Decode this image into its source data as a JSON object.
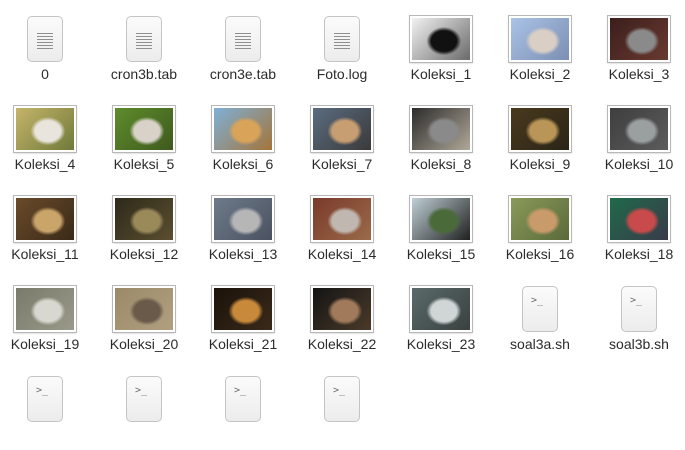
{
  "files": [
    {
      "name": "0",
      "kind": "text",
      "icon": "text-document-icon"
    },
    {
      "name": "cron3b.tab",
      "kind": "text",
      "icon": "text-document-icon"
    },
    {
      "name": "cron3e.tab",
      "kind": "text",
      "icon": "text-document-icon"
    },
    {
      "name": "Foto.log",
      "kind": "text",
      "icon": "text-document-icon"
    },
    {
      "name": "Koleksi_1",
      "kind": "image",
      "icon": "image-thumbnail-icon",
      "colors": [
        "#f2f2f2",
        "#111111",
        "#6a6a6a"
      ]
    },
    {
      "name": "Koleksi_2",
      "kind": "image",
      "icon": "image-thumbnail-icon",
      "colors": [
        "#aac3e6",
        "#d9cfc4",
        "#7c8fb3"
      ]
    },
    {
      "name": "Koleksi_3",
      "kind": "image",
      "icon": "image-thumbnail-icon",
      "colors": [
        "#3b1e1c",
        "#8a8a8a",
        "#6a3a30"
      ]
    },
    {
      "name": "Koleksi_4",
      "kind": "image",
      "icon": "image-thumbnail-icon",
      "colors": [
        "#c6b46a",
        "#e9e4dc",
        "#6f7a3a"
      ]
    },
    {
      "name": "Koleksi_5",
      "kind": "image",
      "icon": "image-thumbnail-icon",
      "colors": [
        "#5e8c2c",
        "#d8d2c8",
        "#3e5a1e"
      ]
    },
    {
      "name": "Koleksi_6",
      "kind": "image",
      "icon": "image-thumbnail-icon",
      "colors": [
        "#7fb0d6",
        "#d9a35a",
        "#a3743a"
      ]
    },
    {
      "name": "Koleksi_7",
      "kind": "image",
      "icon": "image-thumbnail-icon",
      "colors": [
        "#5a6c80",
        "#c79d72",
        "#3a3a3a"
      ]
    },
    {
      "name": "Koleksi_8",
      "kind": "image",
      "icon": "image-thumbnail-icon",
      "colors": [
        "#2c2c2c",
        "#8a8a8a",
        "#b0a898"
      ]
    },
    {
      "name": "Koleksi_9",
      "kind": "image",
      "icon": "image-thumbnail-icon",
      "colors": [
        "#4a3a1e",
        "#b99558",
        "#2a2416"
      ]
    },
    {
      "name": "Koleksi_10",
      "kind": "image",
      "icon": "image-thumbnail-icon",
      "colors": [
        "#3e3e3e",
        "#9aa0a0",
        "#5c5c5c"
      ]
    },
    {
      "name": "Koleksi_11",
      "kind": "image",
      "icon": "image-thumbnail-icon",
      "colors": [
        "#6a4a2a",
        "#caa56a",
        "#3a2a18"
      ]
    },
    {
      "name": "Koleksi_12",
      "kind": "image",
      "icon": "image-thumbnail-icon",
      "colors": [
        "#2e2a1a",
        "#9a8a5a",
        "#5a4e30"
      ]
    },
    {
      "name": "Koleksi_13",
      "kind": "image",
      "icon": "image-thumbnail-icon",
      "colors": [
        "#6e7a8a",
        "#b6b6b6",
        "#4a5260"
      ]
    },
    {
      "name": "Koleksi_14",
      "kind": "image",
      "icon": "image-thumbnail-icon",
      "colors": [
        "#7a3a2a",
        "#c0b8b0",
        "#9a6a4a"
      ]
    },
    {
      "name": "Koleksi_15",
      "kind": "image",
      "icon": "image-thumbnail-icon",
      "colors": [
        "#bfcfd6",
        "#4a6a3a",
        "#202020"
      ]
    },
    {
      "name": "Koleksi_16",
      "kind": "image",
      "icon": "image-thumbnail-icon",
      "colors": [
        "#8a9a5a",
        "#c99a6a",
        "#5a6a3a"
      ]
    },
    {
      "name": "Koleksi_18",
      "kind": "image",
      "icon": "image-thumbnail-icon",
      "colors": [
        "#1f6a4a",
        "#c84a4a",
        "#3a3a4a"
      ]
    },
    {
      "name": "Koleksi_19",
      "kind": "image",
      "icon": "image-thumbnail-icon",
      "colors": [
        "#7a7a6a",
        "#d8d8d0",
        "#9a9a8a"
      ]
    },
    {
      "name": "Koleksi_20",
      "kind": "image",
      "icon": "image-thumbnail-icon",
      "colors": [
        "#9a8a6a",
        "#6a5a4a",
        "#b0a080"
      ]
    },
    {
      "name": "Koleksi_21",
      "kind": "image",
      "icon": "image-thumbnail-icon",
      "colors": [
        "#1a120a",
        "#c88a3a",
        "#3a2a1a"
      ]
    },
    {
      "name": "Koleksi_22",
      "kind": "image",
      "icon": "image-thumbnail-icon",
      "colors": [
        "#141414",
        "#a07a5a",
        "#4a3a2a"
      ]
    },
    {
      "name": "Koleksi_23",
      "kind": "image",
      "icon": "image-thumbnail-icon",
      "colors": [
        "#5a6a6a",
        "#d0d6d6",
        "#3a4040"
      ]
    },
    {
      "name": "soal3a.sh",
      "kind": "script",
      "icon": "shell-script-icon"
    },
    {
      "name": "soal3b.sh",
      "kind": "script",
      "icon": "shell-script-icon"
    },
    {
      "name": "",
      "kind": "script",
      "icon": "shell-script-icon"
    },
    {
      "name": "",
      "kind": "script",
      "icon": "shell-script-icon"
    },
    {
      "name": "",
      "kind": "script",
      "icon": "shell-script-icon"
    },
    {
      "name": "",
      "kind": "script",
      "icon": "shell-script-icon"
    }
  ]
}
